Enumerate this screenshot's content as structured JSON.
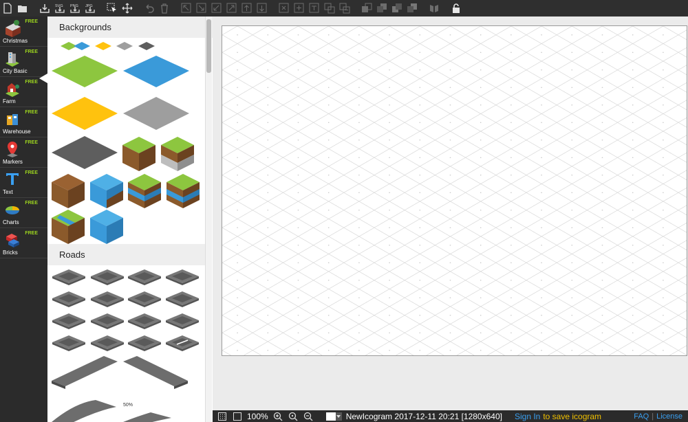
{
  "toolbar": {
    "buttons": [
      {
        "name": "new-file-icon"
      },
      {
        "name": "open-folder-icon"
      },
      {
        "name": "download-icon"
      },
      {
        "name": "export-svg-icon",
        "label": "SVG"
      },
      {
        "name": "export-png-icon",
        "label": "PNG"
      },
      {
        "name": "export-jpg-icon",
        "label": "JPG"
      },
      {
        "name": "select-tool-icon"
      },
      {
        "name": "move-tool-icon"
      },
      {
        "name": "undo-icon"
      },
      {
        "name": "trash-icon"
      }
    ]
  },
  "categories": [
    {
      "label": "Christmas",
      "badge": "FREE",
      "icon": "christmas-icon",
      "color": "#c0392b"
    },
    {
      "label": "City Basic",
      "badge": "FREE",
      "icon": "city-basic-icon",
      "color": "#8bc34a"
    },
    {
      "label": "Farm",
      "badge": "FREE",
      "icon": "farm-icon",
      "color": "#d04a2a"
    },
    {
      "label": "Warehouse",
      "badge": "FREE",
      "icon": "warehouse-icon",
      "color": "#3c8fd6"
    },
    {
      "label": "Markers",
      "badge": "FREE",
      "icon": "marker-icon",
      "color": "#e53935"
    },
    {
      "label": "Text",
      "badge": "FREE",
      "icon": "text-icon",
      "color": "#3a9ff0"
    },
    {
      "label": "Charts",
      "badge": "FREE",
      "icon": "chart-icon",
      "color": "#f0b400"
    },
    {
      "label": "Bricks",
      "badge": "FREE",
      "icon": "bricks-icon",
      "color": "#e53935"
    }
  ],
  "library": {
    "sections": [
      {
        "title": "Backgrounds"
      },
      {
        "title": "Roads"
      }
    ],
    "percent_label": "50%"
  },
  "colors": {
    "green": "#8dc63f",
    "blue": "#3a9ad9",
    "yellow": "#ffc20e",
    "gray": "#9e9e9e",
    "dark": "#5e5e5e",
    "dirt": "#8b5a2b"
  },
  "status": {
    "zoom": "100%",
    "document": "NewIcogram 2017-12-11 20:21 [1280x640]",
    "sign_in": "Sign In",
    "save_text": "to save icogram",
    "faq": "FAQ",
    "separator": "|",
    "license": "License"
  }
}
